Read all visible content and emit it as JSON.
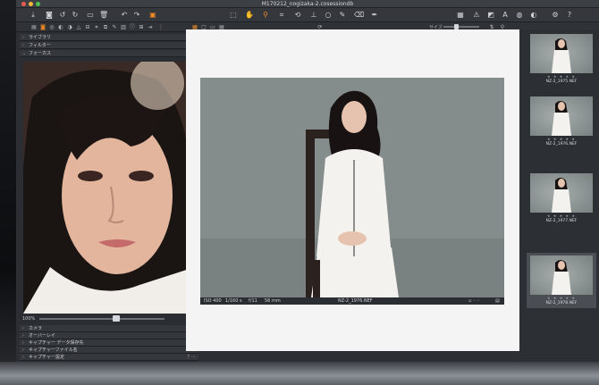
{
  "window": {
    "title": "M170212_nogizaka-2.cosessiondb"
  },
  "toolbar": {
    "left_icons": [
      "download-icon",
      "camera-icon",
      "rotate-left-icon",
      "rotate-right-icon",
      "folder-icon",
      "trash-icon",
      "undo-icon",
      "redo-icon",
      "compare-icon"
    ],
    "center_icons": [
      "select-icon",
      "pan-icon",
      "zoom-icon",
      "crop-icon",
      "rotate-icon",
      "straighten-icon",
      "keystone-icon",
      "brush-icon",
      "eraser-icon",
      "color-picker-icon"
    ],
    "right_icons": [
      "grid-icon",
      "warning-icon",
      "exposure-icon",
      "text-icon",
      "focus-icon",
      "color-icon",
      "settings-icon",
      "help-icon"
    ]
  },
  "subbar": {
    "size_label": "サイズ"
  },
  "left_panel": {
    "tools": [
      {
        "label": "ライブラリ"
      },
      {
        "label": "フィルター"
      },
      {
        "label": "フォーカス"
      }
    ],
    "zoom_label": "100%",
    "bottom_tools": [
      {
        "label": "カメラ"
      },
      {
        "label": "オーバーレイ"
      },
      {
        "label": "キャプチャー データ保存先"
      },
      {
        "label": "キャプチャーファイル名"
      },
      {
        "label": "キャプチャー設定"
      }
    ]
  },
  "viewer": {
    "info": {
      "iso": "ISO 400",
      "shutter": "1/160 s",
      "aperture": "f/11",
      "focal": "56 mm",
      "filename": "NZ-2_1976.NEF"
    }
  },
  "filmstrip": {
    "thumbs": [
      {
        "name": "NZ-2_1975.NEF",
        "stars": "★ ★ ★ ★ ★",
        "selected": false
      },
      {
        "name": "NZ-2_1976.NEF",
        "stars": "★ ★ ★ ★ ★",
        "selected": false
      },
      {
        "name": "NZ-2_1977.NEF",
        "stars": "★ ★ ★ ★ ★",
        "selected": false
      },
      {
        "name": "NZ-2_1978.NEF",
        "stars": "★ ★ ★ ★ ★",
        "selected": true
      }
    ]
  },
  "colors": {
    "accent": "#f08a24",
    "panel": "#2a2d31",
    "viewer_bg": "#f4f4f4"
  }
}
